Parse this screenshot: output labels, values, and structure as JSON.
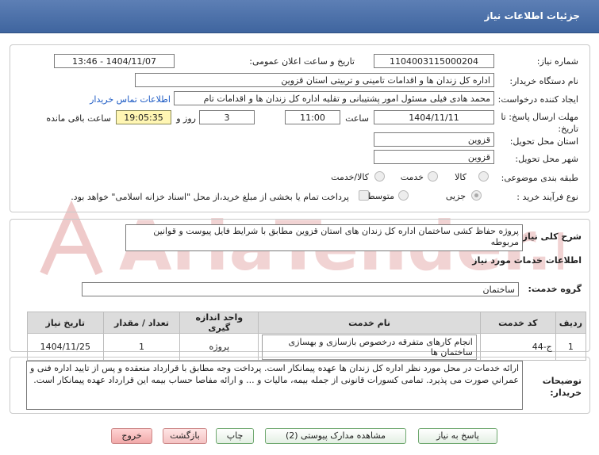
{
  "header": {
    "title": "جزئیات اطلاعات نیاز"
  },
  "form": {
    "need_number_label": "شماره نیاز:",
    "need_number": "1104003115000204",
    "announce_label": "تاریخ و ساعت اعلان عمومی:",
    "announce_value": "1404/11/07 - 13:46",
    "buyer_label": "نام دستگاه خریدار:",
    "buyer_value": "اداره کل زندان ها و اقدامات تامینی و تربیتی استان قزوین",
    "creator_label": "ایجاد کننده درخواست:",
    "creator_value": "محمد هادی فیلی مسئول امور پشتیبانی و تقلیه اداره کل زندان ها و اقدامات تام",
    "contact_link": "اطلاعات تماس خریدار",
    "deadline_label": "مهلت ارسال پاسخ: تا",
    "deadline_label2": "تاریخ:",
    "deadline_date": "1404/11/11",
    "hour_label": "ساعت",
    "deadline_time": "11:00",
    "days_value": "3",
    "days_label": "روز و",
    "remaining_time": "19:05:35",
    "remaining_label": "ساعت باقی مانده",
    "province_label": "استان محل تحویل:",
    "province_value": "قزوین",
    "city_label": "شهر محل تحویل:",
    "city_value": "قزوین",
    "category_label": "طبقه بندی موضوعی:",
    "category_options": [
      "کالا",
      "خدمت",
      "کالا/خدمت"
    ],
    "process_label": "نوع فرآیند خرید :",
    "process_options": [
      "جزیی",
      "متوسط"
    ],
    "treasury_note": "پرداخت تمام یا بخشی از مبلغ خرید،از محل \"اسناد خزانه اسلامی\" خواهد بود."
  },
  "summary": {
    "label": "شرح کلی نیاز:",
    "value": "پروژه حفاظ کشی ساختمان اداره کل زندان های استان قزوین مطابق با شرایط فایل پیوست و قوانین مربوطه"
  },
  "services": {
    "heading": "اطلاعات خدمات مورد نیاز",
    "group_label": "گروه خدمت:",
    "group_value": "ساختمان",
    "columns": [
      "ردیف",
      "کد خدمت",
      "نام خدمت",
      "واحد اندازه گیری",
      "تعداد / مقدار",
      "تاریخ نیاز"
    ],
    "rows": [
      {
        "row": "1",
        "code": "ج-44",
        "name": "انجام کارهای متفرقه درخصوص بازسازی و بهسازی ساختمان ها",
        "unit": "پروژه",
        "qty": "1",
        "date": "1404/11/25"
      }
    ]
  },
  "buyer_notes": {
    "label1": "توضیحات",
    "label2": "خریدار:",
    "value": "ارائه خدمات در محل مورد نظر اداره کل زندان ها عهده پیمانکار است. پرداخت وجه مطابق با قرارداد منعقده و پس از تایید اداره فنی و عمراني صورت می پذیرد. تمامی کسورات قانونی از جمله بیمه، مالیات و ... و ارائه مفاصا حساب بیمه این قرارداد عهده پیمانکار است."
  },
  "buttons": {
    "reply": "پاسخ به نیاز",
    "attachments": "مشاهده مدارک پیوستی (2)",
    "print": "چاپ",
    "back": "بازگشت",
    "exit": "خروج"
  },
  "watermark": {
    "text": "AriaTender.net"
  },
  "colors": {
    "header": "#4a6fa8",
    "time_bg": "#fff6b3",
    "link": "#1c5ac4",
    "watermark": "#e9b9b9"
  }
}
